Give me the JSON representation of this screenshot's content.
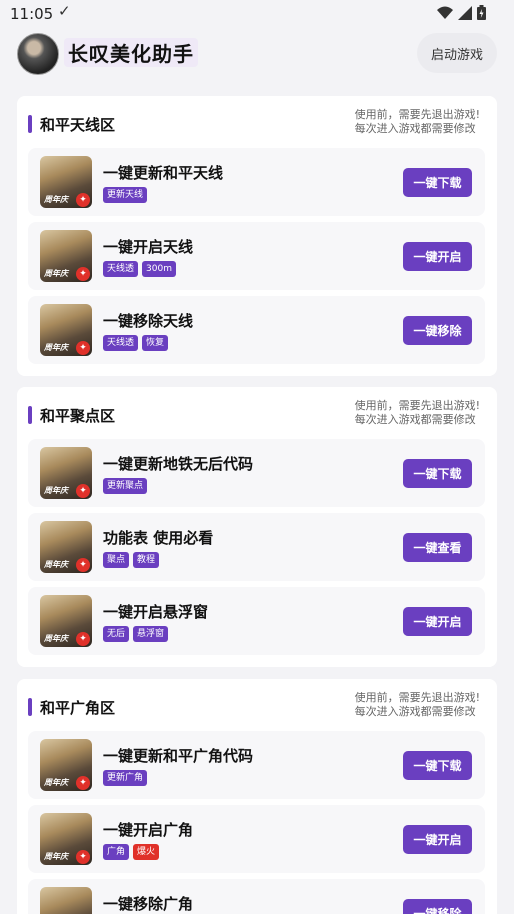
{
  "status": {
    "time": "11:05",
    "icons": [
      "wifi-icon",
      "signal-icon",
      "battery-icon"
    ]
  },
  "app": {
    "title": "长叹美化助手",
    "start_button": "启动游戏"
  },
  "notice": [
    "使用前，需要先退出游戏!",
    "每次进入游戏都需要修改"
  ],
  "sections": [
    {
      "title": "和平天线区",
      "items": [
        {
          "title": "一键更新和平天线",
          "tags": [
            {
              "text": "更新天线",
              "color": "purple"
            }
          ],
          "button": "一键下载"
        },
        {
          "title": "一键开启天线",
          "tags": [
            {
              "text": "天线透",
              "color": "purple"
            },
            {
              "text": "300m",
              "color": "purple"
            }
          ],
          "button": "一键开启"
        },
        {
          "title": "一键移除天线",
          "tags": [
            {
              "text": "天线透",
              "color": "purple"
            },
            {
              "text": "恢复",
              "color": "purple"
            }
          ],
          "button": "一键移除"
        }
      ]
    },
    {
      "title": "和平聚点区",
      "items": [
        {
          "title": "一键更新地铁无后代码",
          "tags": [
            {
              "text": "更新聚点",
              "color": "purple"
            }
          ],
          "button": "一键下载"
        },
        {
          "title": "功能表 使用必看",
          "tags": [
            {
              "text": "聚点",
              "color": "purple"
            },
            {
              "text": "教程",
              "color": "purple"
            }
          ],
          "button": "一键查看"
        },
        {
          "title": "一键开启悬浮窗",
          "tags": [
            {
              "text": "无后",
              "color": "purple"
            },
            {
              "text": "悬浮窗",
              "color": "purple"
            }
          ],
          "button": "一键开启"
        }
      ]
    },
    {
      "title": "和平广角区",
      "items": [
        {
          "title": "一键更新和平广角代码",
          "tags": [
            {
              "text": "更新广角",
              "color": "purple"
            }
          ],
          "button": "一键下载"
        },
        {
          "title": "一键开启广角",
          "tags": [
            {
              "text": "广角",
              "color": "purple"
            },
            {
              "text": "爆火",
              "color": "red"
            }
          ],
          "button": "一键开启"
        },
        {
          "title": "一键移除广角",
          "tags": [],
          "button": "一键移除"
        }
      ]
    }
  ],
  "game_icon_badge": "周年庆",
  "colors": {
    "accent": "#6a3fc0",
    "hot": "#e0312a"
  }
}
